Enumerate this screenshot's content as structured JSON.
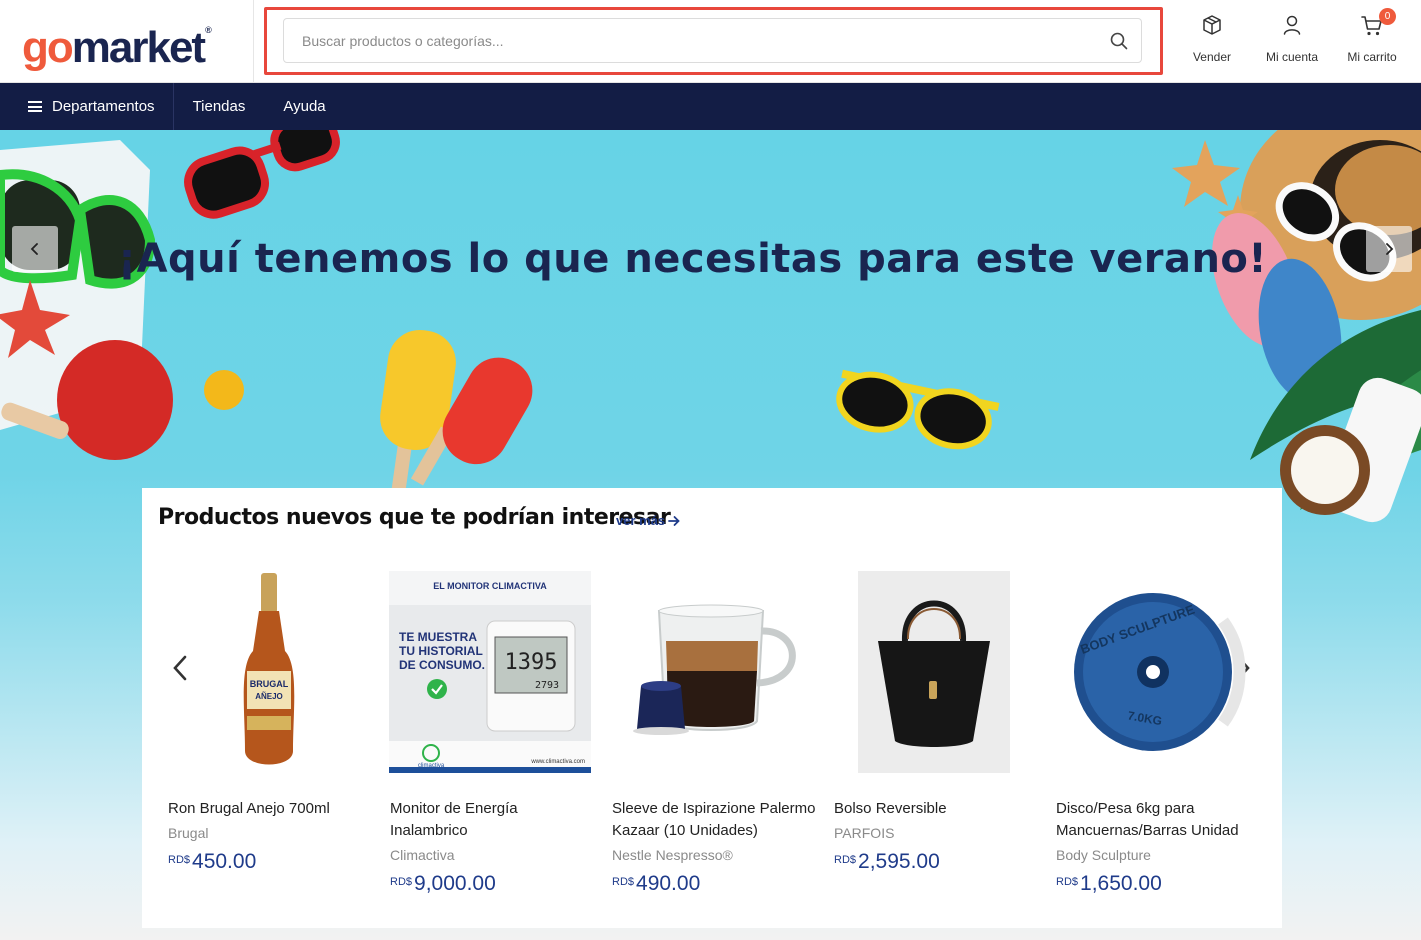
{
  "header": {
    "logo_go": "go",
    "logo_market": "market",
    "logo_reg": "®",
    "search": {
      "placeholder": "Buscar productos o categorías..."
    },
    "actions": [
      {
        "label": "Vender",
        "icon": "box-icon"
      },
      {
        "label": "Mi cuenta",
        "icon": "user-icon"
      },
      {
        "label": "Mi carrito",
        "icon": "cart-icon",
        "badge": "0"
      }
    ]
  },
  "nav": {
    "items": [
      "Departamentos",
      "Tiendas",
      "Ayuda"
    ]
  },
  "hero": {
    "title": "¡Aquí tenemos lo que necesitas para este verano!"
  },
  "products": {
    "title": "Productos nuevos que te podrían interesar",
    "see_more": "ver más",
    "items": [
      {
        "name": "Ron Brugal Anejo 700ml",
        "brand": "Brugal",
        "currency": "RD$",
        "price": "450.00"
      },
      {
        "name": "Monitor de Energía Inalambrico",
        "brand": "Climactiva",
        "currency": "RD$",
        "price": "9,000.00"
      },
      {
        "name": "Sleeve de Ispirazione Palermo Kazaar (10 Unidades)",
        "brand": "Nestle Nespresso®",
        "currency": "RD$",
        "price": "490.00"
      },
      {
        "name": "Bolso Reversible",
        "brand": "PARFOIS",
        "currency": "RD$",
        "price": "2,595.00"
      },
      {
        "name": "Disco/Pesa 6kg para Mancuernas/Barras Unidad",
        "brand": "Body Sculpture",
        "currency": "RD$",
        "price": "1,650.00"
      }
    ],
    "promo_monitor": {
      "heading": "EL MONITOR CLIMACTIVA",
      "line1": "TE MUESTRA",
      "line2": "TU HISTORIAL",
      "line3": "DE CONSUMO.",
      "display": "1395",
      "display_small": "2793",
      "brand": "climactiva",
      "url": "www.climactiva.com"
    },
    "bottle_label": "BRUGAL",
    "bottle_label2": "AÑEJO",
    "weight_text": "BODY SCULPTURE",
    "weight_text2": "7.0KG"
  },
  "colors": {
    "brand_orange": "#ef5a3c",
    "brand_navy": "#131d45",
    "price_blue": "#1f3b8a",
    "highlight_red": "#e8473c"
  }
}
